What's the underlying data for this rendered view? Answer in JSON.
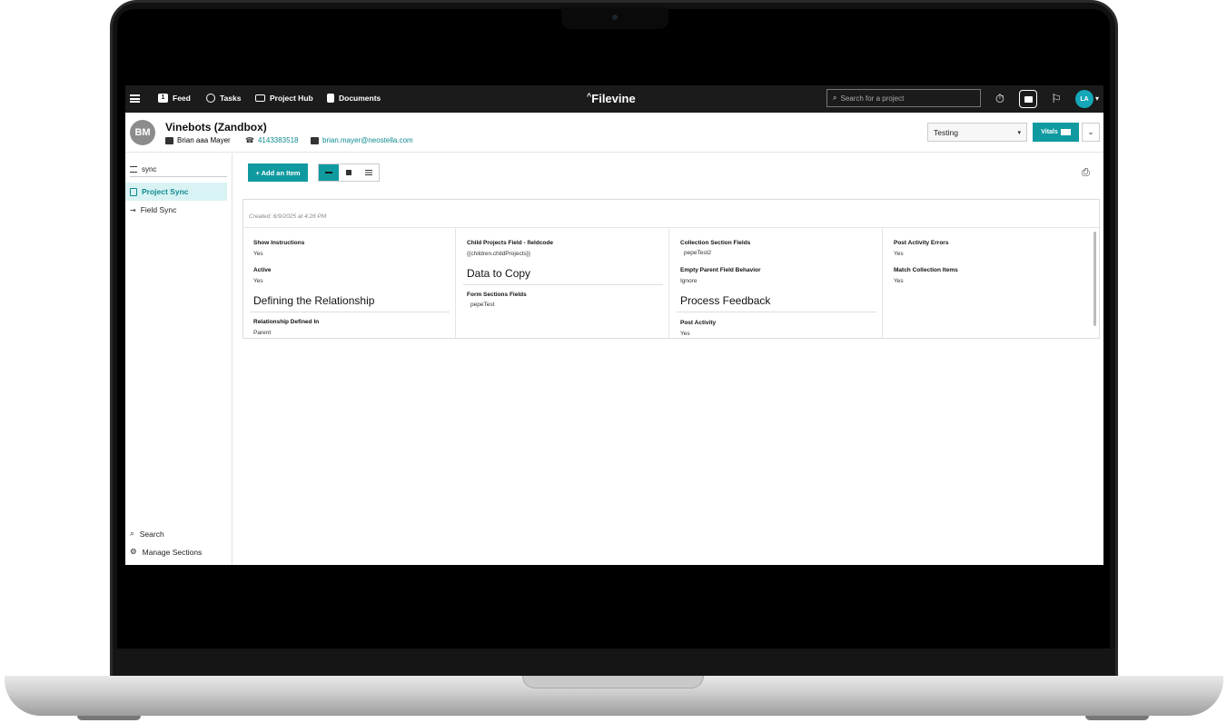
{
  "nav": {
    "items": [
      {
        "label": "Feed",
        "badge": "1"
      },
      {
        "label": "Tasks"
      },
      {
        "label": "Project Hub"
      },
      {
        "label": "Documents"
      }
    ],
    "logo": "Filevine",
    "search_placeholder": "Search for a project",
    "user_initials": "LA"
  },
  "project": {
    "avatar_initials": "BM",
    "title": "Vinebots (Zandbox)",
    "client": "Brian aaa Mayer",
    "phone": "4143383518",
    "email": "brian.mayer@neostella.com",
    "phase": "Testing",
    "vitals_label": "Vitals"
  },
  "sidebar": {
    "filter": "sync",
    "items": [
      {
        "label": "Project Sync",
        "active": true
      },
      {
        "label": "Field Sync",
        "active": false
      }
    ],
    "bottom": [
      {
        "label": "Search"
      },
      {
        "label": "Manage Sections"
      }
    ]
  },
  "toolbar": {
    "add_label": "+ Add an Item"
  },
  "card": {
    "created": "Created: 6/9/2025 at 4:26 PM",
    "col1": {
      "show_instructions_label": "Show Instructions",
      "show_instructions_value": "Yes",
      "active_label": "Active",
      "active_value": "Yes",
      "section": "Defining the Relationship",
      "relationship_label": "Relationship Defined In",
      "relationship_value": "Parent"
    },
    "col2": {
      "child_label": "Child Projects Field - fieldcode",
      "child_value": "{{children.childProjects}}",
      "section": "Data to Copy",
      "form_label": "Form Sections Fields",
      "form_value": "pepeTest"
    },
    "col3": {
      "collection_label": "Collection Section Fields",
      "collection_value": "pepeTest2",
      "empty_label": "Empty Parent Field Behavior",
      "empty_value": "Ignore",
      "section": "Process Feedback",
      "post_label": "Post Activity",
      "post_value": "Yes"
    },
    "col4": {
      "errors_label": "Post Activity Errors",
      "errors_value": "Yes",
      "match_label": "Match Collection Items",
      "match_value": "Yes"
    }
  },
  "colors": {
    "accent": "#0f9aa0",
    "topbar": "#1b1b1b",
    "active_bg": "#d9f3f4"
  }
}
